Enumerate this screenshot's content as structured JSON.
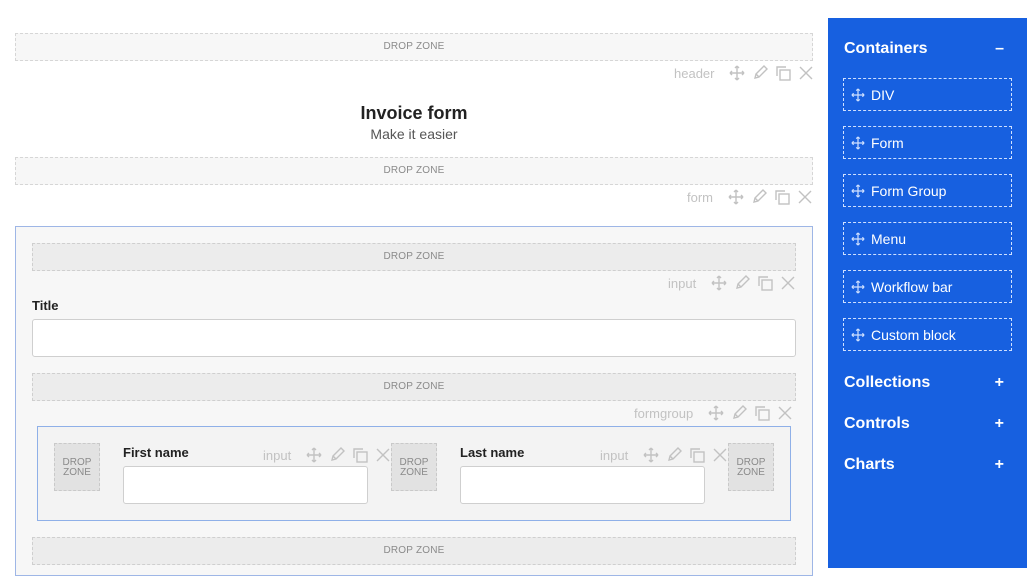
{
  "canvas": {
    "drop_zone": "DROP ZONE",
    "drop_zone_line1": "DROP",
    "drop_zone_line2": "ZONE",
    "header_tag": "header",
    "form_tag": "form",
    "input_tag": "input",
    "formgroup_tag": "formgroup",
    "heading": "Invoice form",
    "subheading": "Make it easier",
    "fields": {
      "title_label": "Title",
      "first_name_label": "First name",
      "last_name_label": "Last name"
    }
  },
  "sidebar": {
    "sections": [
      {
        "label": "Containers",
        "sign": "–"
      },
      {
        "label": "Collections",
        "sign": "+"
      },
      {
        "label": "Controls",
        "sign": "+"
      },
      {
        "label": "Charts",
        "sign": "+"
      }
    ],
    "containers": [
      "DIV",
      "Form",
      "Form Group",
      "Menu",
      "Workflow bar",
      "Custom block"
    ]
  },
  "colors": {
    "sidebar_bg": "#1760e0",
    "selection_border": "#9eb6e6"
  }
}
